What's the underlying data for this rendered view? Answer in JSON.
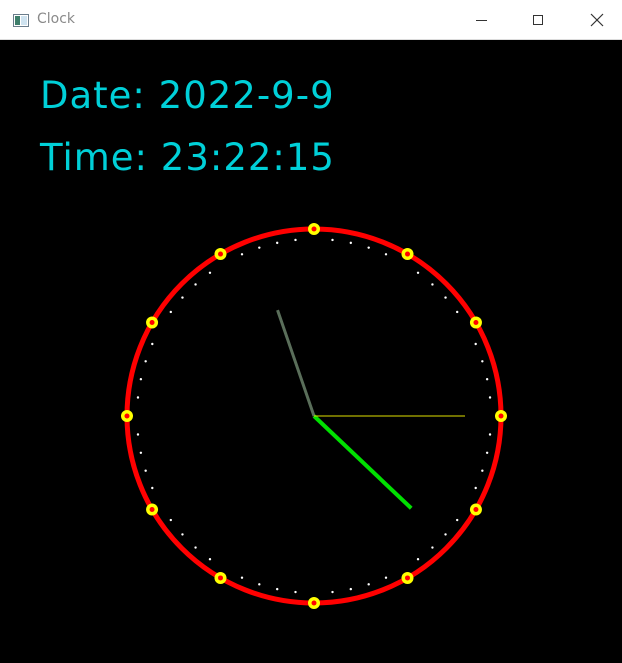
{
  "window": {
    "title": "Clock",
    "app_icon": "window-app-icon",
    "controls": {
      "minimize_icon": "minimize-icon",
      "maximize_icon": "maximize-icon",
      "close_icon": "close-icon"
    }
  },
  "display": {
    "date_label": "Date:",
    "date_value": "2022-9-9",
    "time_label": "Time:",
    "time_value": "23:22:15"
  },
  "clock": {
    "hour": 23,
    "minute": 22,
    "second": 15,
    "hour_marks": 12,
    "minute_marks": 60,
    "colors": {
      "background": "#000000",
      "dial": "#ff0000",
      "hour_marker_outer": "#ffff00",
      "hour_marker_inner": "#ff0000",
      "minute_dots": "#ffffff",
      "hour_hand": "#5a6e5a",
      "minute_hand": "#00e000",
      "second_hand": "#e0e000",
      "text": "#00d0d8"
    }
  }
}
